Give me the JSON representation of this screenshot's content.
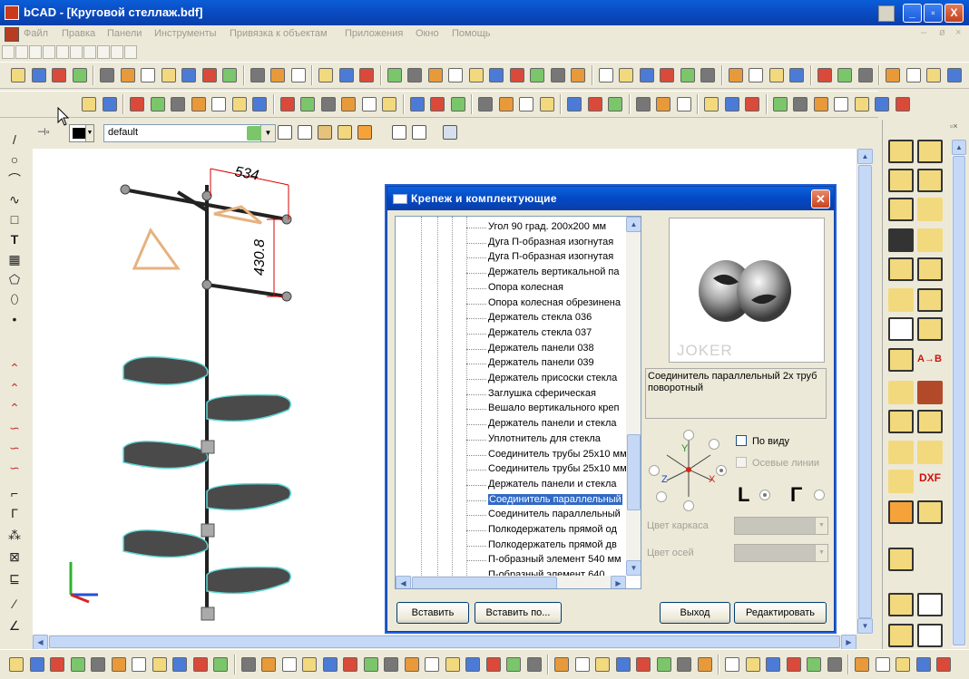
{
  "window": {
    "title": "bCAD - [Круговой стеллаж.bdf]",
    "controls": [
      "_",
      "▫",
      "X"
    ]
  },
  "menu": {
    "items": [
      "Файл",
      "Правка",
      "Панели",
      "Инструменты",
      "Привязка к объектам",
      "Приложения",
      "Окно",
      "Помощь"
    ],
    "mdi_controls": [
      "–",
      "ø",
      "×"
    ]
  },
  "layer_toolbar": {
    "color": "#000000",
    "layer_value": "default"
  },
  "drawing": {
    "dim_top": "534",
    "dim_side": "430.8"
  },
  "dialog": {
    "title": "Крепеж и комплектующие",
    "list_items": [
      "Угол 90 град. 200x200 мм",
      "Дуга П-образная изогнутая",
      "Дуга П-образная изогнутая",
      "Держатель вертикальной па",
      "Опора колесная",
      "Опора колесная обрезинена",
      "Держатель стекла 036",
      "Держатель стекла 037",
      "Держатель панели 038",
      "Держатель панели 039",
      "Держатель присоски стекла",
      "Заглушка сферическая",
      "Вешало вертикального креп",
      "Держатель панели и стекла",
      "Уплотнитель для стекла",
      "Соединитель трубы 25x10 мм",
      "Соединитель трубы 25x10 мм",
      "Держатель панели и стекла",
      "Соединитель параллельный",
      "Соединитель параллельный",
      "Полкодержатель прямой од",
      "Полкодержатель прямой дв",
      "П-образный элемент  540 мм",
      "П-образный элемент  640"
    ],
    "selected_index": 18,
    "preview_brand": "JOKER",
    "description": "Соединитель параллельный 2х труб поворотный",
    "axes": {
      "x": "X",
      "y": "Y",
      "z": "Z"
    },
    "checkboxes": {
      "by_view": "По виду",
      "axis_lines": "Осевые линии"
    },
    "frame_color_label": "Цвет каркаса",
    "axis_color_label": "Цвет осей",
    "buttons": {
      "insert": "Вставить",
      "insert_by": "Вставить по...",
      "exit": "Выход",
      "edit": "Редактировать"
    }
  },
  "right_palette": {
    "text_tool": "A→B",
    "dxf_label": "DXF"
  }
}
